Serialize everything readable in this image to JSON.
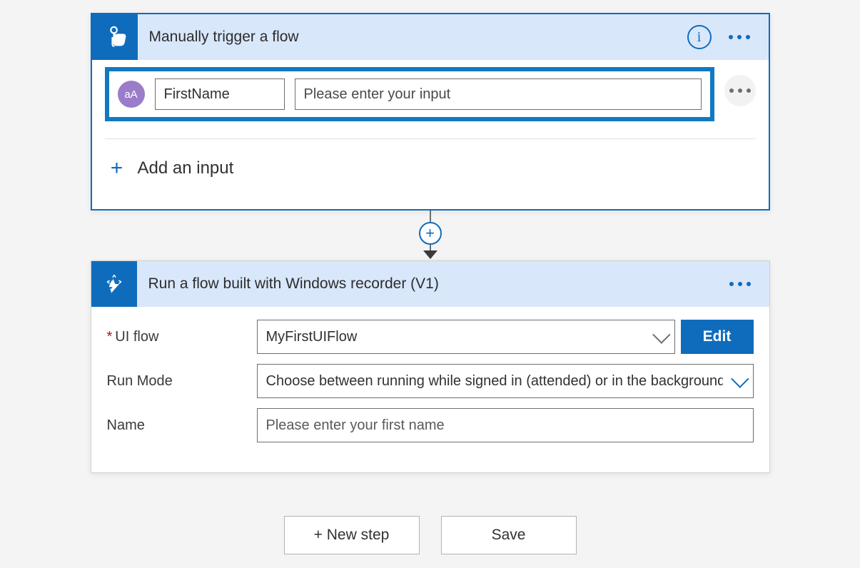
{
  "trigger": {
    "title": "Manually trigger a flow",
    "inputRow": {
      "typeBadge": "aA",
      "name": "FirstName",
      "description": "Please enter your input"
    },
    "addInputLabel": "Add an input"
  },
  "connector": {
    "addLabel": "+"
  },
  "action": {
    "title": "Run a flow built with Windows recorder (V1)",
    "fields": {
      "uiflow": {
        "label": "UI flow",
        "value": "MyFirstUIFlow",
        "editLabel": "Edit"
      },
      "runmode": {
        "label": "Run Mode",
        "placeholder": "Choose between running while signed in (attended) or in the background"
      },
      "name": {
        "label": "Name",
        "placeholder": "Please enter your first name"
      }
    }
  },
  "footer": {
    "newStep": "+ New step",
    "save": "Save"
  },
  "info": {
    "glyph": "i"
  }
}
